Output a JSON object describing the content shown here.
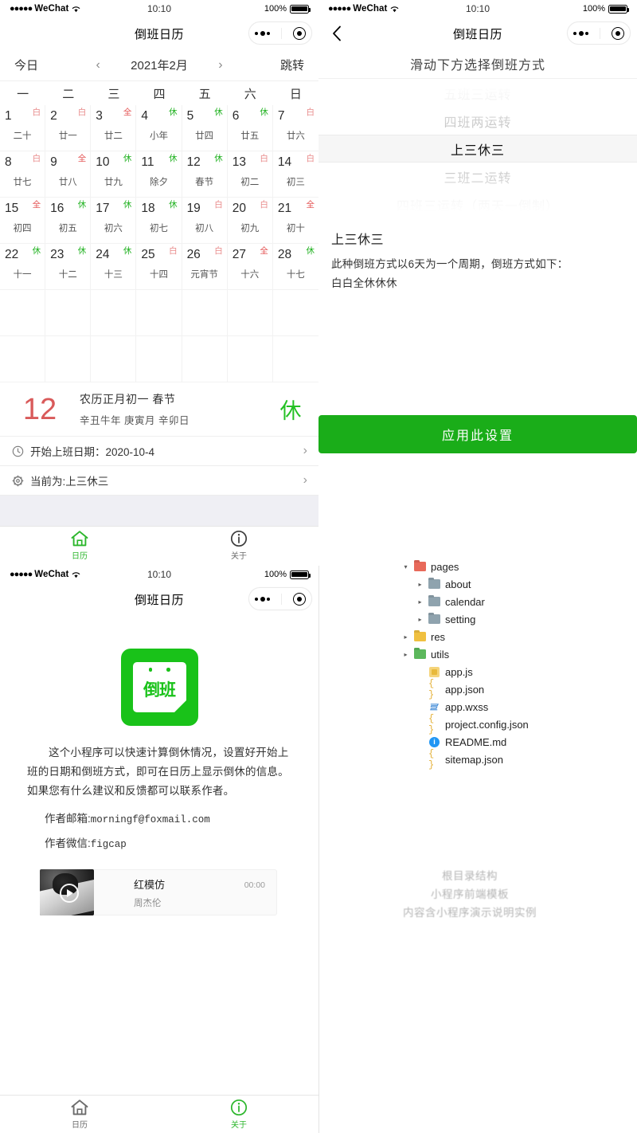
{
  "status_bar": {
    "carrier": "WeChat",
    "dots": "●●●●●",
    "time": "10:10",
    "battery": "100%"
  },
  "screen_calendar": {
    "nav_title": "倒班日历",
    "toolbar": {
      "today": "今日",
      "prev": "‹",
      "month": "2021年2月",
      "next": "›",
      "jump": "跳转"
    },
    "weekdays": [
      "一",
      "二",
      "三",
      "四",
      "五",
      "六",
      "日"
    ],
    "days": [
      {
        "num": "1",
        "lunar": "二十",
        "badge": "白",
        "badge_type": "work"
      },
      {
        "num": "2",
        "lunar": "廿一",
        "badge": "白",
        "badge_type": "work"
      },
      {
        "num": "3",
        "lunar": "廿二",
        "badge": "全",
        "badge_type": "full"
      },
      {
        "num": "4",
        "lunar": "小年",
        "badge": "休",
        "badge_type": "rest"
      },
      {
        "num": "5",
        "lunar": "廿四",
        "badge": "休",
        "badge_type": "rest"
      },
      {
        "num": "6",
        "lunar": "廿五",
        "badge": "休",
        "badge_type": "rest"
      },
      {
        "num": "7",
        "lunar": "廿六",
        "badge": "白",
        "badge_type": "work"
      },
      {
        "num": "8",
        "lunar": "廿七",
        "badge": "白",
        "badge_type": "work"
      },
      {
        "num": "9",
        "lunar": "廿八",
        "badge": "全",
        "badge_type": "full"
      },
      {
        "num": "10",
        "lunar": "廿九",
        "badge": "休",
        "badge_type": "rest"
      },
      {
        "num": "11",
        "lunar": "除夕",
        "badge": "休",
        "badge_type": "rest"
      },
      {
        "num": "12",
        "lunar": "春节",
        "badge": "休",
        "badge_type": "rest"
      },
      {
        "num": "13",
        "lunar": "初二",
        "badge": "白",
        "badge_type": "work"
      },
      {
        "num": "14",
        "lunar": "初三",
        "badge": "白",
        "badge_type": "work"
      },
      {
        "num": "15",
        "lunar": "初四",
        "badge": "全",
        "badge_type": "full"
      },
      {
        "num": "16",
        "lunar": "初五",
        "badge": "休",
        "badge_type": "rest"
      },
      {
        "num": "17",
        "lunar": "初六",
        "badge": "休",
        "badge_type": "rest"
      },
      {
        "num": "18",
        "lunar": "初七",
        "badge": "休",
        "badge_type": "rest"
      },
      {
        "num": "19",
        "lunar": "初八",
        "badge": "白",
        "badge_type": "work"
      },
      {
        "num": "20",
        "lunar": "初九",
        "badge": "白",
        "badge_type": "work"
      },
      {
        "num": "21",
        "lunar": "初十",
        "badge": "全",
        "badge_type": "full"
      },
      {
        "num": "22",
        "lunar": "十一",
        "badge": "休",
        "badge_type": "rest"
      },
      {
        "num": "23",
        "lunar": "十二",
        "badge": "休",
        "badge_type": "rest"
      },
      {
        "num": "24",
        "lunar": "十三",
        "badge": "休",
        "badge_type": "rest"
      },
      {
        "num": "25",
        "lunar": "十四",
        "badge": "白",
        "badge_type": "work"
      },
      {
        "num": "26",
        "lunar": "元宵节",
        "badge": "白",
        "badge_type": "work"
      },
      {
        "num": "27",
        "lunar": "十六",
        "badge": "全",
        "badge_type": "full"
      },
      {
        "num": "28",
        "lunar": "十七",
        "badge": "休",
        "badge_type": "rest"
      }
    ],
    "empty_cells": 14,
    "detail": {
      "day": "12",
      "lunar_full": "农历正月初一  春节",
      "ganzhi": "辛丑牛年  庚寅月  辛卯日",
      "status": "休"
    },
    "rows": [
      {
        "icon": "clock-icon",
        "label": "开始上班日期：2020-10-4",
        "chevron": "›"
      },
      {
        "icon": "gear-icon",
        "label": "当前为:上三休三",
        "chevron": "›"
      }
    ],
    "tabs": [
      {
        "label": "日历",
        "icon": "home-icon",
        "active": true
      },
      {
        "label": "关于",
        "icon": "info-icon",
        "active": false
      }
    ]
  },
  "screen_setting": {
    "nav_title": "倒班日历",
    "back": "‹",
    "subtitle": "滑动下方选择倒班方式",
    "picker_options": [
      "五班三运转",
      "四班两运转",
      "上三休三",
      "三班二运转",
      "四班三运转（两天一倒制）"
    ],
    "picker_selected_index": 2,
    "desc_title": "上三休三",
    "desc_line1": "此种倒班方式以6天为一个周期，倒班方式如下：",
    "desc_line2": "白白全休休休",
    "apply_label": "应用此设置",
    "apply_color": "#1aad19"
  },
  "screen_about": {
    "nav_title": "倒班日历",
    "logo_text": "倒班",
    "logo_color": "#19c219",
    "body": "这个小程序可以快速计算倒休情况，设置好开始上班的日期和倒班方式，即可在日历上显示倒休的信息。如果您有什么建议和反馈都可以联系作者。",
    "email_label": "作者邮箱:",
    "email_value": "morningf@foxmail.com",
    "wechat_label": "作者微信:",
    "wechat_value": "figcap",
    "music": {
      "title": "红模仿",
      "artist": "周杰伦",
      "time": "00:00"
    },
    "tabs": [
      {
        "label": "日历",
        "icon": "home-icon",
        "active": false
      },
      {
        "label": "关于",
        "icon": "info-icon",
        "active": true
      }
    ]
  },
  "file_tree": {
    "items": [
      {
        "name": "pages",
        "type": "folder",
        "caret": "▾",
        "indent": 0,
        "color": "#e8695a"
      },
      {
        "name": "about",
        "type": "folder",
        "caret": "▸",
        "indent": 1,
        "color": "#8fa3ae"
      },
      {
        "name": "calendar",
        "type": "folder",
        "caret": "▸",
        "indent": 1,
        "color": "#8fa3ae"
      },
      {
        "name": "setting",
        "type": "folder",
        "caret": "▸",
        "indent": 1,
        "color": "#8fa3ae"
      },
      {
        "name": "res",
        "type": "folder",
        "caret": "▸",
        "indent": 0,
        "color": "#f0c040"
      },
      {
        "name": "utils",
        "type": "folder",
        "caret": "▸",
        "indent": 0,
        "color": "#5cb85c"
      },
      {
        "name": "app.js",
        "type": "js",
        "caret": "",
        "indent": 1,
        "color": "#f5d47a"
      },
      {
        "name": "app.json",
        "type": "json",
        "caret": "",
        "indent": 1,
        "color": "#e4b23c"
      },
      {
        "name": "app.wxss",
        "type": "wxss",
        "caret": "",
        "indent": 1,
        "color": "#4a90d9"
      },
      {
        "name": "project.config.json",
        "type": "json",
        "caret": "",
        "indent": 1,
        "color": "#e4b23c"
      },
      {
        "name": "README.md",
        "type": "md",
        "caret": "",
        "indent": 1,
        "color": "#2196f3"
      },
      {
        "name": "sitemap.json",
        "type": "json",
        "caret": "",
        "indent": 1,
        "color": "#e4b23c"
      }
    ],
    "watermark_lines": [
      "根目录结构",
      "小程序前端模板",
      "内容含小程序演示说明实例"
    ]
  }
}
